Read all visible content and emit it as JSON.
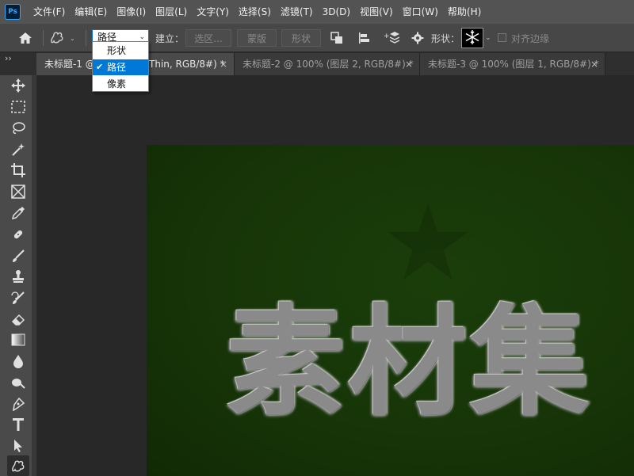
{
  "menubar": {
    "app_logo": "Ps",
    "items": [
      "文件(F)",
      "编辑(E)",
      "图像(I)",
      "图层(L)",
      "文字(Y)",
      "选择(S)",
      "滤镜(T)",
      "3D(D)",
      "视图(V)",
      "窗口(W)",
      "帮助(H)"
    ]
  },
  "options": {
    "mode_value": "路径",
    "make_label": "建立：",
    "selection_btn": "选区...",
    "mask_btn": "蒙版",
    "shape_btn": "形状",
    "shape_label": "形状：",
    "align_edges_label": "对齐边缘"
  },
  "mode_dropdown": {
    "options": [
      "形状",
      "路径",
      "像素"
    ],
    "selected": "路径"
  },
  "tabs": {
    "collapse_glyph": "››",
    "items": [
      {
        "label": "未标题-1 @",
        "label_suffix": "Thin, RGB/8#) *",
        "active": true
      },
      {
        "label": "未标题-2 @ 100% (图层 2, RGB/8#) *",
        "active": false
      },
      {
        "label": "未标题-3 @ 100% (图层 1, RGB/8#) *",
        "active": false
      }
    ]
  },
  "toolbar": {
    "tools": [
      "move-icon",
      "marquee-icon",
      "lasso-icon",
      "magic-wand-icon",
      "crop-icon",
      "frame-icon",
      "eyedropper-icon",
      "healing-brush-icon",
      "brush-icon",
      "clone-stamp-icon",
      "history-brush-icon",
      "eraser-icon",
      "gradient-icon",
      "blur-icon",
      "dodge-icon",
      "pen-icon",
      "type-icon",
      "path-selection-icon",
      "custom-shape-icon"
    ],
    "active_tool": "custom-shape-icon"
  },
  "canvas": {
    "text": "素材集"
  },
  "colors": {
    "menubar": "#535353",
    "optionsbar": "#474747",
    "toolbar": "#4a4a4a",
    "canvas_bg": "#173508",
    "accent": "#0078d7"
  }
}
